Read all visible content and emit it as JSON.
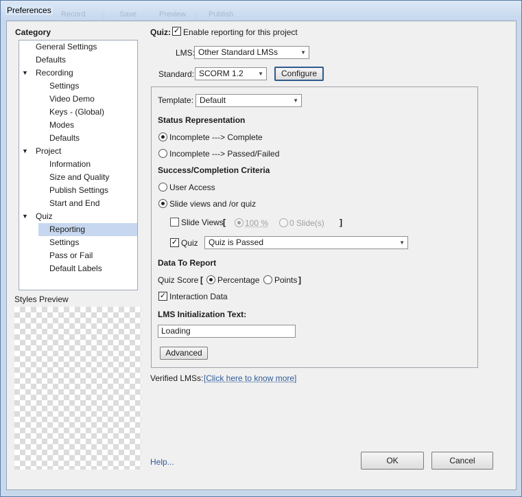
{
  "window": {
    "title": "Preferences",
    "bg_toolbar": [
      "Record",
      "Save",
      "Preview",
      "Publish"
    ]
  },
  "sidebar": {
    "heading": "Category",
    "items": [
      {
        "label": "General Settings",
        "level": 0
      },
      {
        "label": "Defaults",
        "level": 0
      },
      {
        "label": "Recording",
        "level": 0,
        "expanded": true
      },
      {
        "label": "Settings",
        "level": 1
      },
      {
        "label": "Video Demo",
        "level": 1
      },
      {
        "label": "Keys - (Global)",
        "level": 1
      },
      {
        "label": "Modes",
        "level": 1
      },
      {
        "label": "Defaults",
        "level": 1
      },
      {
        "label": "Project",
        "level": 0,
        "expanded": true
      },
      {
        "label": "Information",
        "level": 1
      },
      {
        "label": "Size and Quality",
        "level": 1
      },
      {
        "label": "Publish Settings",
        "level": 1
      },
      {
        "label": "Start and End",
        "level": 1
      },
      {
        "label": "Quiz",
        "level": 0,
        "expanded": true
      },
      {
        "label": "Reporting",
        "level": 1,
        "selected": true
      },
      {
        "label": "Settings",
        "level": 1
      },
      {
        "label": "Pass or Fail",
        "level": 1
      },
      {
        "label": "Default Labels",
        "level": 1
      }
    ],
    "styles_preview_label": "Styles Preview"
  },
  "main": {
    "quiz_label": "Quiz:",
    "enable_reporting": {
      "label": "Enable reporting for this project",
      "checked": true
    },
    "lms": {
      "label": "LMS:",
      "value": "Other Standard LMSs"
    },
    "standard": {
      "label": "Standard:",
      "value": "SCORM 1.2"
    },
    "configure_button": "Configure",
    "template": {
      "label": "Template:",
      "value": "Default"
    },
    "status_representation": {
      "heading": "Status Representation",
      "options": [
        {
          "label": "Incomplete ---> Complete",
          "selected": true
        },
        {
          "label": "Incomplete ---> Passed/Failed",
          "selected": false
        }
      ]
    },
    "criteria": {
      "heading": "Success/Completion Criteria",
      "user_access": {
        "label": "User Access",
        "selected": false
      },
      "slide_views_quiz": {
        "label": "Slide views and /or quiz",
        "selected": true
      },
      "slide_views": {
        "label": "Slide Views",
        "checked": false,
        "open_bracket": "[",
        "close_bracket": "]",
        "percent_option": {
          "label": "100 %",
          "selected": true
        },
        "slides_option": {
          "label": "0 Slide(s)",
          "selected": false
        }
      },
      "quiz": {
        "label": "Quiz",
        "checked": true,
        "value": "Quiz is Passed"
      }
    },
    "data_to_report": {
      "heading": "Data To Report",
      "quiz_score_label": "Quiz Score",
      "open_bracket": "[",
      "close_bracket": "]",
      "percentage": {
        "label": "Percentage",
        "selected": true
      },
      "points": {
        "label": "Points",
        "selected": false
      },
      "interaction_data": {
        "label": "Interaction Data",
        "checked": true
      }
    },
    "lms_init": {
      "heading": "LMS Initialization Text:",
      "value": "Loading"
    },
    "advanced_button": "Advanced",
    "verified_lms": {
      "label": "Verified LMSs:",
      "link": "[Click here to know more]"
    }
  },
  "footer": {
    "help_link": "Help...",
    "ok_button": "OK",
    "cancel_button": "Cancel"
  },
  "glyphs": {
    "check": "✓",
    "tri_down": "▼"
  }
}
